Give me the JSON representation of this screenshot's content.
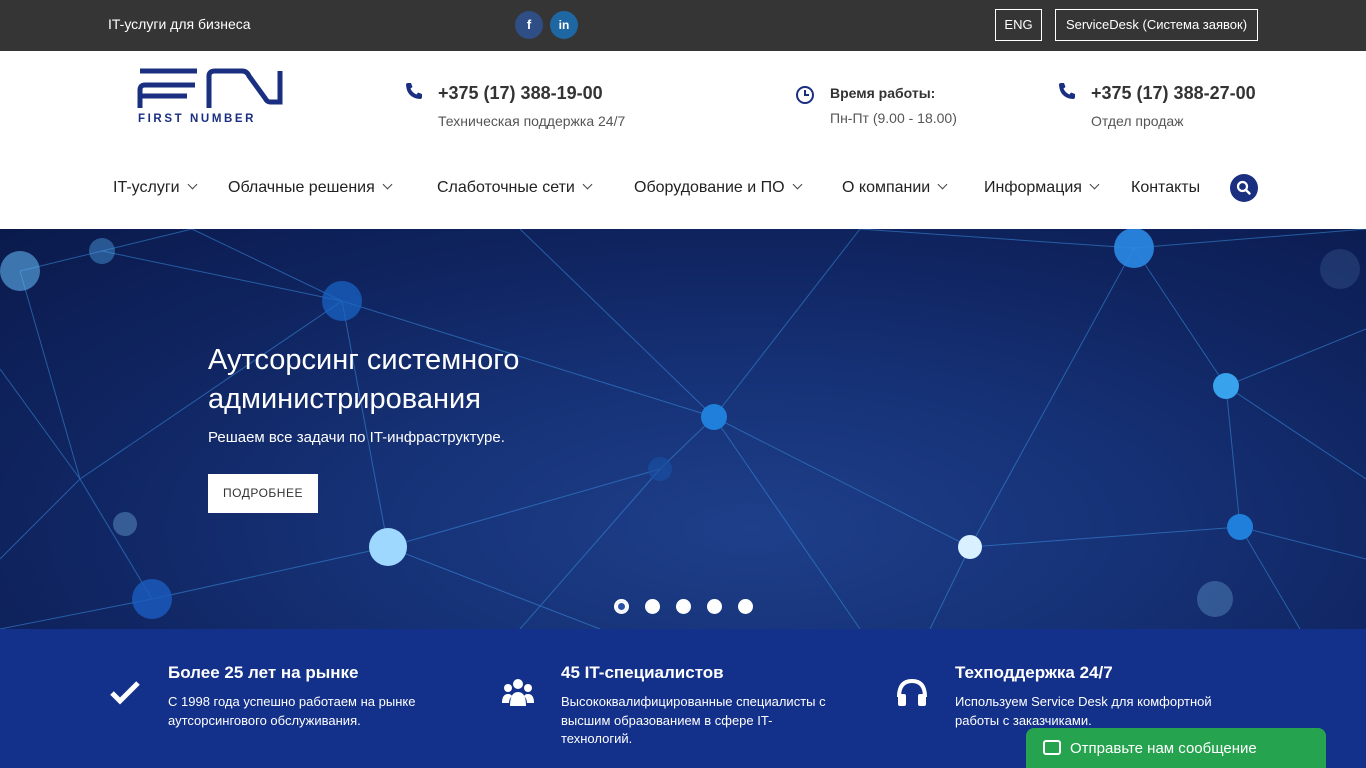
{
  "topbar": {
    "tagline": "IT-услуги для бизнеса",
    "social": [
      {
        "icon": "facebook-icon",
        "glyph": "f"
      },
      {
        "icon": "linkedin-icon",
        "glyph": "in"
      }
    ],
    "lang_button": "ENG",
    "servicedesk_button": "ServiceDesk (Система заявок)"
  },
  "header": {
    "logo_text": "FIRST NUMBER",
    "contacts": [
      {
        "icon": "phone-icon",
        "main": "+375 (17) 388-19-00",
        "sub": "Техническая поддержка 24/7"
      },
      {
        "icon": "clock-icon",
        "main": "Время работы:",
        "sub": "Пн-Пт (9.00 - 18.00)"
      },
      {
        "icon": "phone-icon",
        "main": "+375 (17) 388-27-00",
        "sub": "Отдел продаж"
      }
    ]
  },
  "nav": {
    "items": [
      {
        "label": "IT-услуги",
        "dropdown": true
      },
      {
        "label": "Облачные решения",
        "dropdown": true
      },
      {
        "label": "Слаботочные сети",
        "dropdown": true
      },
      {
        "label": "Оборудование и ПО",
        "dropdown": true
      },
      {
        "label": "О компании",
        "dropdown": true
      },
      {
        "label": "Информация",
        "dropdown": true
      },
      {
        "label": "Контакты",
        "dropdown": false
      }
    ],
    "search_icon": "search-icon"
  },
  "hero": {
    "title": "Аутсорсинг системного администрирования",
    "subtitle": "Решаем все задачи по IT-инфраструктуре.",
    "button": "ПОДРОБНЕЕ",
    "slides_count": 5,
    "active_slide": 1
  },
  "features": [
    {
      "icon": "checkmark-icon",
      "title": "Более 25 лет на рынке",
      "text": "С 1998 года успешно работаем на рынке аутсорсингового обслуживания."
    },
    {
      "icon": "users-icon",
      "title": "45 IT-специалистов",
      "text": "Высококвалифицированные специалисты с высшим образованием в сфере IT-технологий."
    },
    {
      "icon": "headphones-icon",
      "title": "Техподдержка 24/7",
      "text": "Используем Service Desk для комфортной работы с заказчиками."
    }
  ],
  "chat": {
    "label": "Отправьте нам сообщение",
    "icon": "message-icon"
  },
  "colors": {
    "brand": "#1a2f80",
    "topbar": "#353535",
    "features_bg": "#13308a",
    "chat": "#26a34e"
  }
}
